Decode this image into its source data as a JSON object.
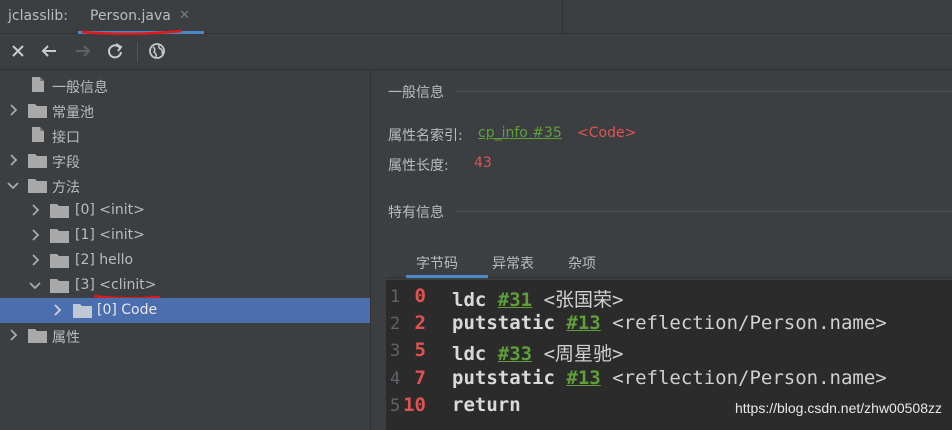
{
  "app": {
    "label": "jclasslib:"
  },
  "tab": {
    "title": "Person.java",
    "close": "✕"
  },
  "toolbar": {
    "buttons": [
      {
        "name": "close-icon"
      },
      {
        "name": "back-arrow-icon"
      },
      {
        "name": "forward-arrow-icon"
      },
      {
        "name": "refresh-icon"
      },
      {
        "name": "globe-icon"
      }
    ]
  },
  "tree": {
    "general": "一般信息",
    "constant_pool": "常量池",
    "interfaces": "接口",
    "fields": "字段",
    "methods": "方法",
    "method_0": "[0] <init>",
    "method_1": "[1] <init>",
    "method_2": "[2] hello",
    "method_3": "[3] <clinit>",
    "code": "[0] Code",
    "attributes": "属性"
  },
  "detail": {
    "general_header": "一般信息",
    "name_index_label": "属性名索引:",
    "name_index_link": "cp_info #35",
    "name_index_value": "<Code>",
    "length_label": "属性长度:",
    "length_value": "43",
    "specific_header": "特有信息",
    "subtabs": [
      "字节码",
      "异常表",
      "杂项"
    ]
  },
  "bytecode": [
    {
      "line": "1",
      "offset": "0",
      "op": "ldc",
      "ref": "#31",
      "comment": "<张国荣>"
    },
    {
      "line": "2",
      "offset": "2",
      "op": "putstatic",
      "ref": "#13",
      "comment": "<reflection/Person.name>"
    },
    {
      "line": "3",
      "offset": "5",
      "op": "ldc",
      "ref": "#33",
      "comment": "<周星驰>"
    },
    {
      "line": "4",
      "offset": "7",
      "op": "putstatic",
      "ref": "#13",
      "comment": "<reflection/Person.name>"
    },
    {
      "line": "5",
      "offset": "10",
      "op": "return",
      "ref": "",
      "comment": ""
    }
  ],
  "watermark": "https://blog.csdn.net/zhw00508zz",
  "colors": {
    "background": "#3c3f41",
    "selection": "#4b6eaf",
    "link": "#5f9e3a",
    "value": "#e05252",
    "code_bg": "#2b2b2b"
  }
}
